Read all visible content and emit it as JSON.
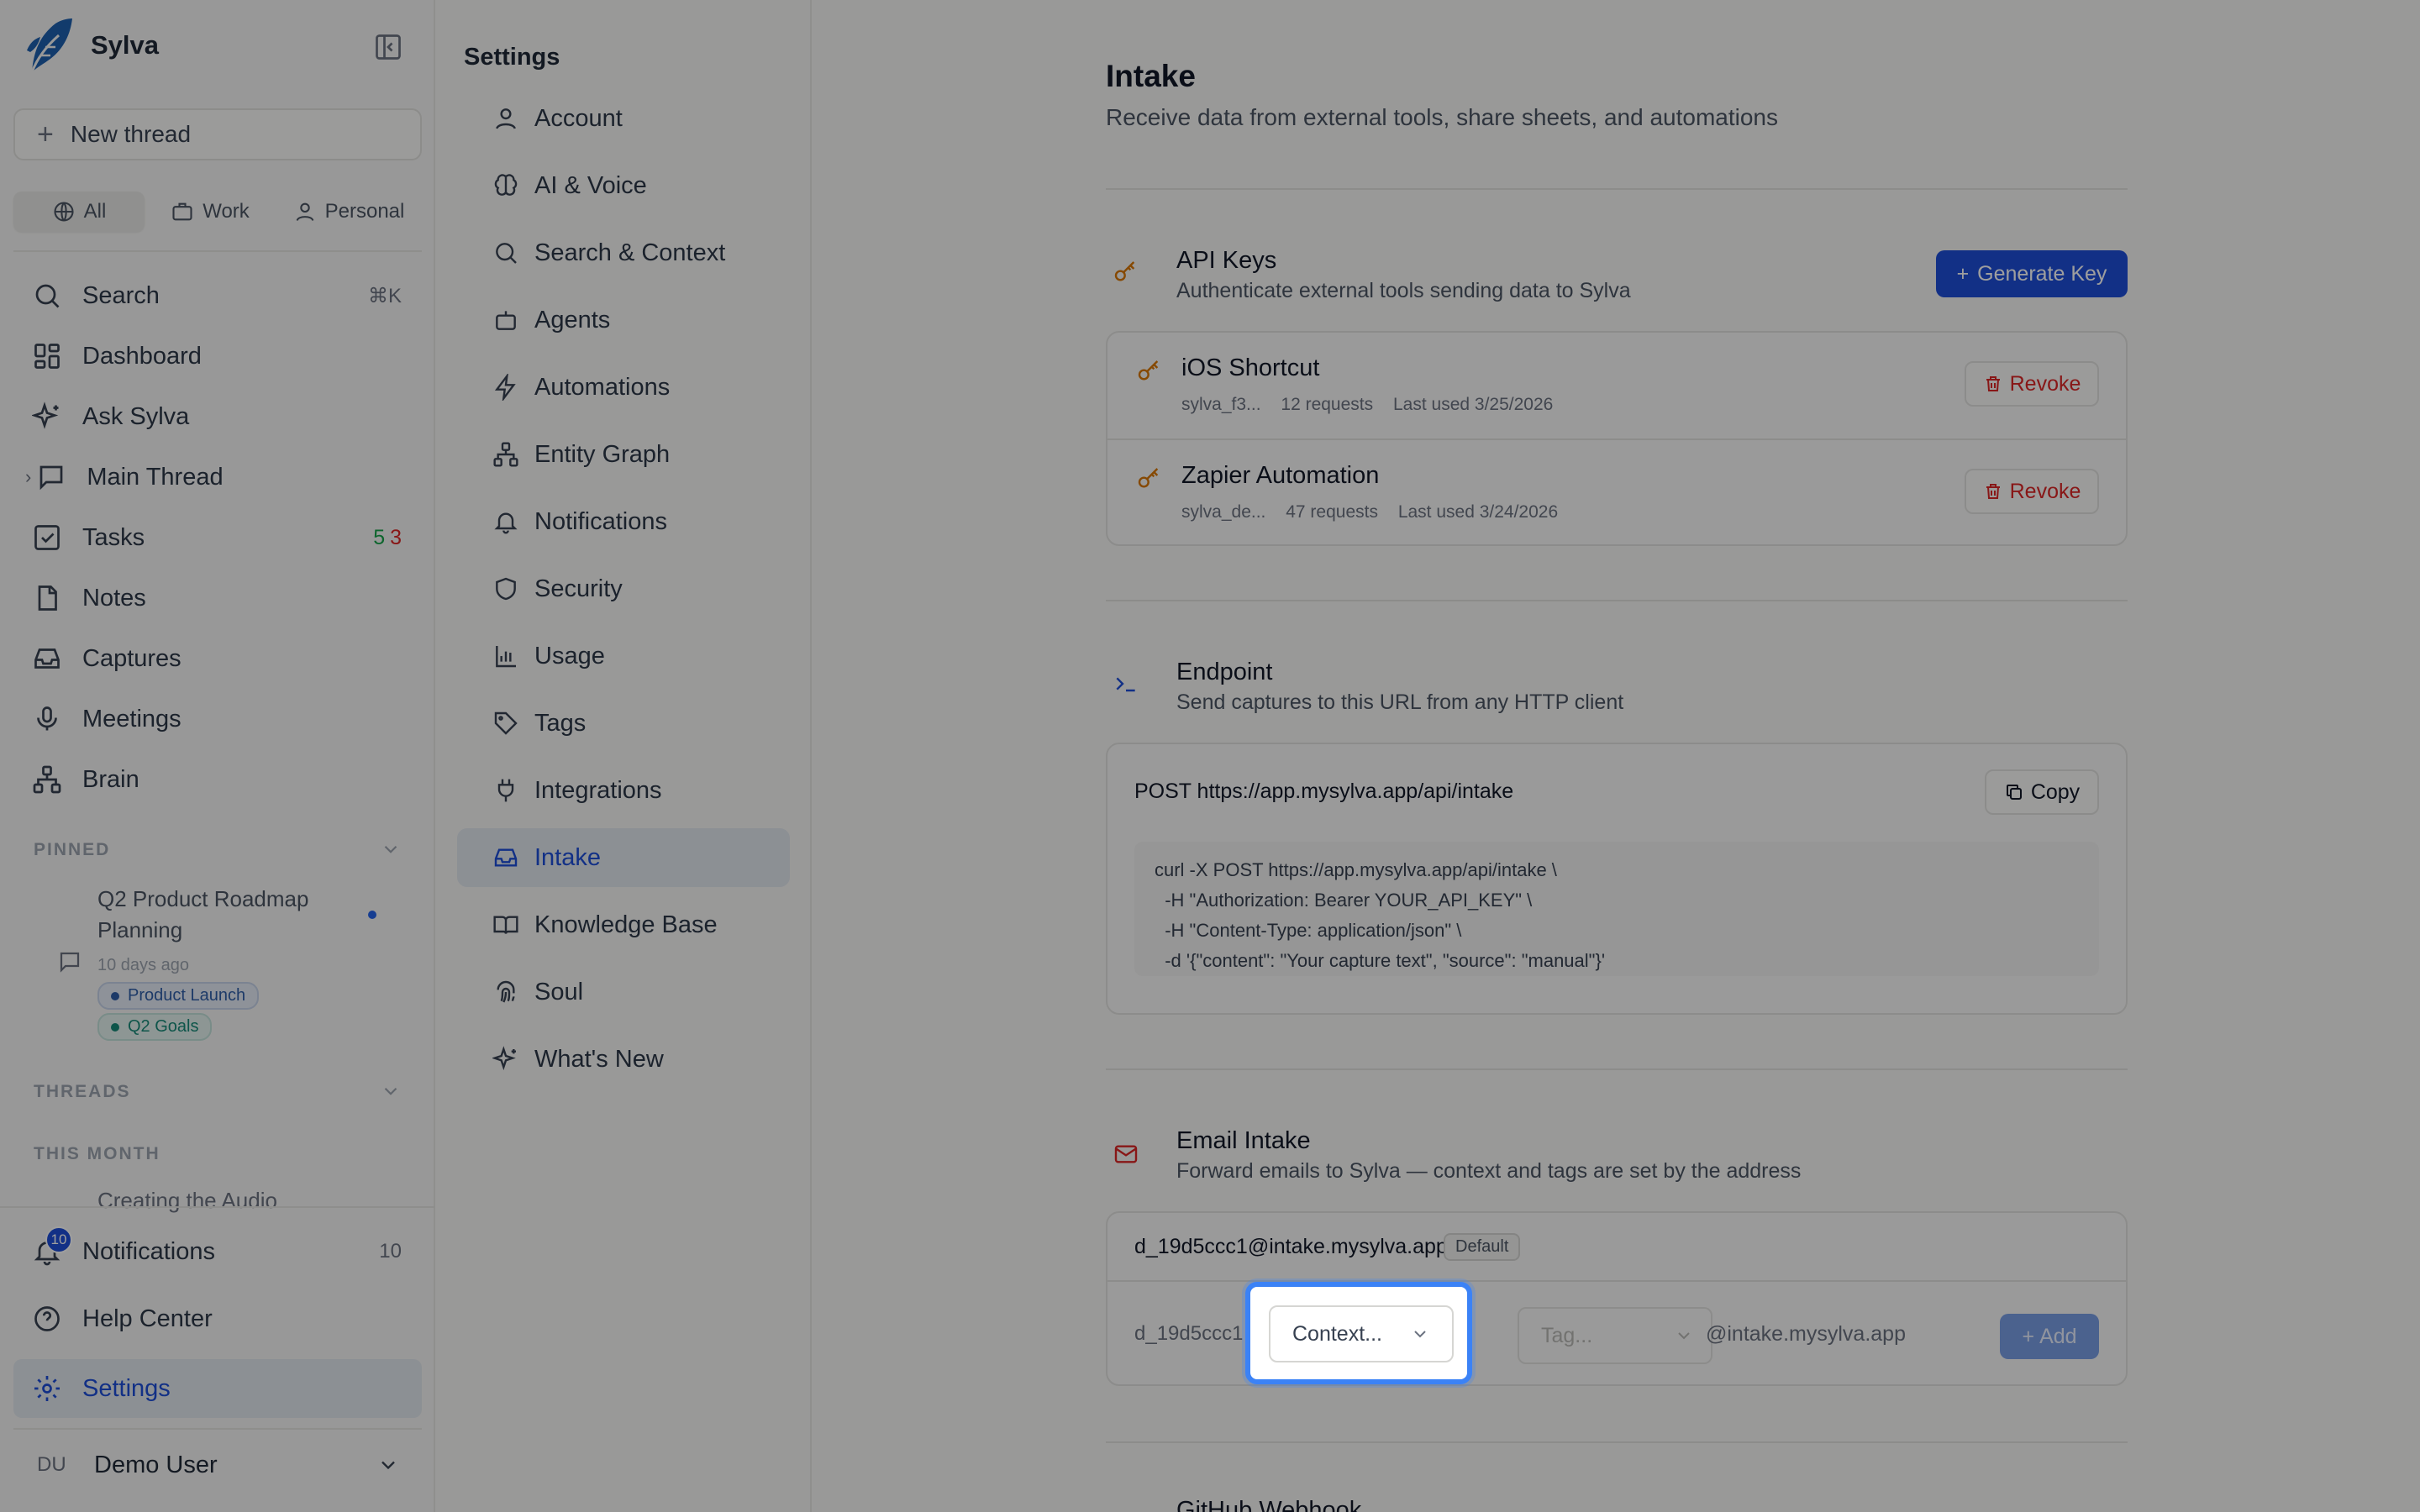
{
  "app": {
    "name": "Sylva"
  },
  "sidebar": {
    "new_thread": "New thread",
    "scopes": [
      {
        "label": "All"
      },
      {
        "label": "Work"
      },
      {
        "label": "Personal"
      }
    ],
    "nav": [
      {
        "label": "Search",
        "shortcut": "⌘K"
      },
      {
        "label": "Dashboard"
      },
      {
        "label": "Ask Sylva"
      },
      {
        "label": "Main Thread"
      },
      {
        "label": "Tasks",
        "count_done": "5",
        "count_overdue": "3"
      },
      {
        "label": "Notes"
      },
      {
        "label": "Captures"
      },
      {
        "label": "Meetings"
      },
      {
        "label": "Brain"
      }
    ],
    "pinned_label": "PINNED",
    "pinned": {
      "title": "Q2 Product Roadmap Planning",
      "time": "10 days ago",
      "tags": [
        "Product Launch",
        "Q2 Goals"
      ]
    },
    "threads_label": "THREADS",
    "this_month_label": "THIS MONTH",
    "faded_thread": "Creating the Audio",
    "notifications": {
      "label": "Notifications",
      "badge": "10",
      "count": "10"
    },
    "help": "Help Center",
    "settings": "Settings",
    "user": {
      "initials": "DU",
      "name": "Demo User"
    }
  },
  "settings_nav": {
    "title": "Settings",
    "items": [
      {
        "label": "Account"
      },
      {
        "label": "AI & Voice"
      },
      {
        "label": "Search & Context"
      },
      {
        "label": "Agents"
      },
      {
        "label": "Automations"
      },
      {
        "label": "Entity Graph"
      },
      {
        "label": "Notifications"
      },
      {
        "label": "Security"
      },
      {
        "label": "Usage"
      },
      {
        "label": "Tags"
      },
      {
        "label": "Integrations"
      },
      {
        "label": "Intake"
      },
      {
        "label": "Knowledge Base"
      },
      {
        "label": "Soul"
      },
      {
        "label": "What's New"
      }
    ]
  },
  "main": {
    "title": "Intake",
    "subtitle": "Receive data from external tools, share sheets, and automations",
    "api_keys": {
      "title": "API Keys",
      "desc": "Authenticate external tools sending data to Sylva",
      "generate": "Generate Key",
      "keys": [
        {
          "name": "iOS Shortcut",
          "prefix": "sylva_f3...",
          "requests": "12 requests",
          "last_used": "Last used 3/25/2026",
          "revoke": "Revoke"
        },
        {
          "name": "Zapier Automation",
          "prefix": "sylva_de...",
          "requests": "47 requests",
          "last_used": "Last used 3/24/2026",
          "revoke": "Revoke"
        }
      ]
    },
    "endpoint": {
      "title": "Endpoint",
      "desc": "Send captures to this URL from any HTTP client",
      "url": "POST https://app.mysylva.app/api/intake",
      "copy": "Copy",
      "code": "curl -X POST https://app.mysylva.app/api/intake \\\n  -H \"Authorization: Bearer YOUR_API_KEY\" \\\n  -H \"Content-Type: application/json\" \\\n  -d '{\"content\": \"Your capture text\", \"source\": \"manual\"}'"
    },
    "email_intake": {
      "title": "Email Intake",
      "desc": "Forward emails to Sylva — context and tags are set by the address",
      "default_address": "d_19d5ccc1@intake.mysylva.app",
      "default_badge": "Default",
      "prefix": "d_19d5ccc1",
      "context_select": "Context...",
      "tag_select": "Tag...",
      "domain": "@intake.mysylva.app",
      "add": "Add"
    },
    "next_section_title": "GitHub Webhook"
  },
  "colors": {
    "accent": "#1d4ed8",
    "danger": "#dc2626",
    "key": "#d97706",
    "focus": "#3b82f6"
  }
}
